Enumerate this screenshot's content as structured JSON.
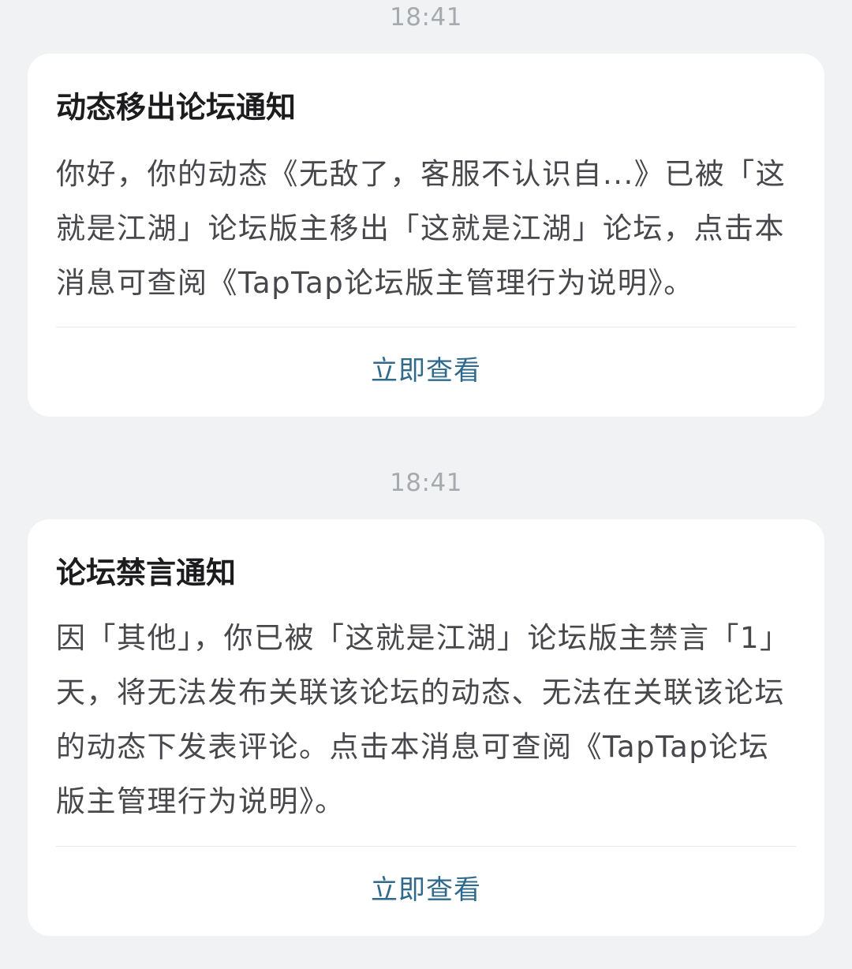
{
  "notifications": [
    {
      "time": "18:41",
      "title": "动态移出论坛通知",
      "body": "你好，你的动态《无敌了，客服不认识自...》已被「这就是江湖」论坛版主移出「这就是江湖」论坛，点击本消息可查阅《TapTap论坛版主管理行为说明》。",
      "action": "立即查看"
    },
    {
      "time": "18:41",
      "title": "论坛禁言通知",
      "body": "因「其他」，你已被「这就是江湖」论坛版主禁言「1」天，将无法发布关联该论坛的动态、无法在关联该论坛的动态下发表评论。点击本消息可查阅《TapTap论坛版主管理行为说明》。",
      "action": "立即查看"
    }
  ]
}
